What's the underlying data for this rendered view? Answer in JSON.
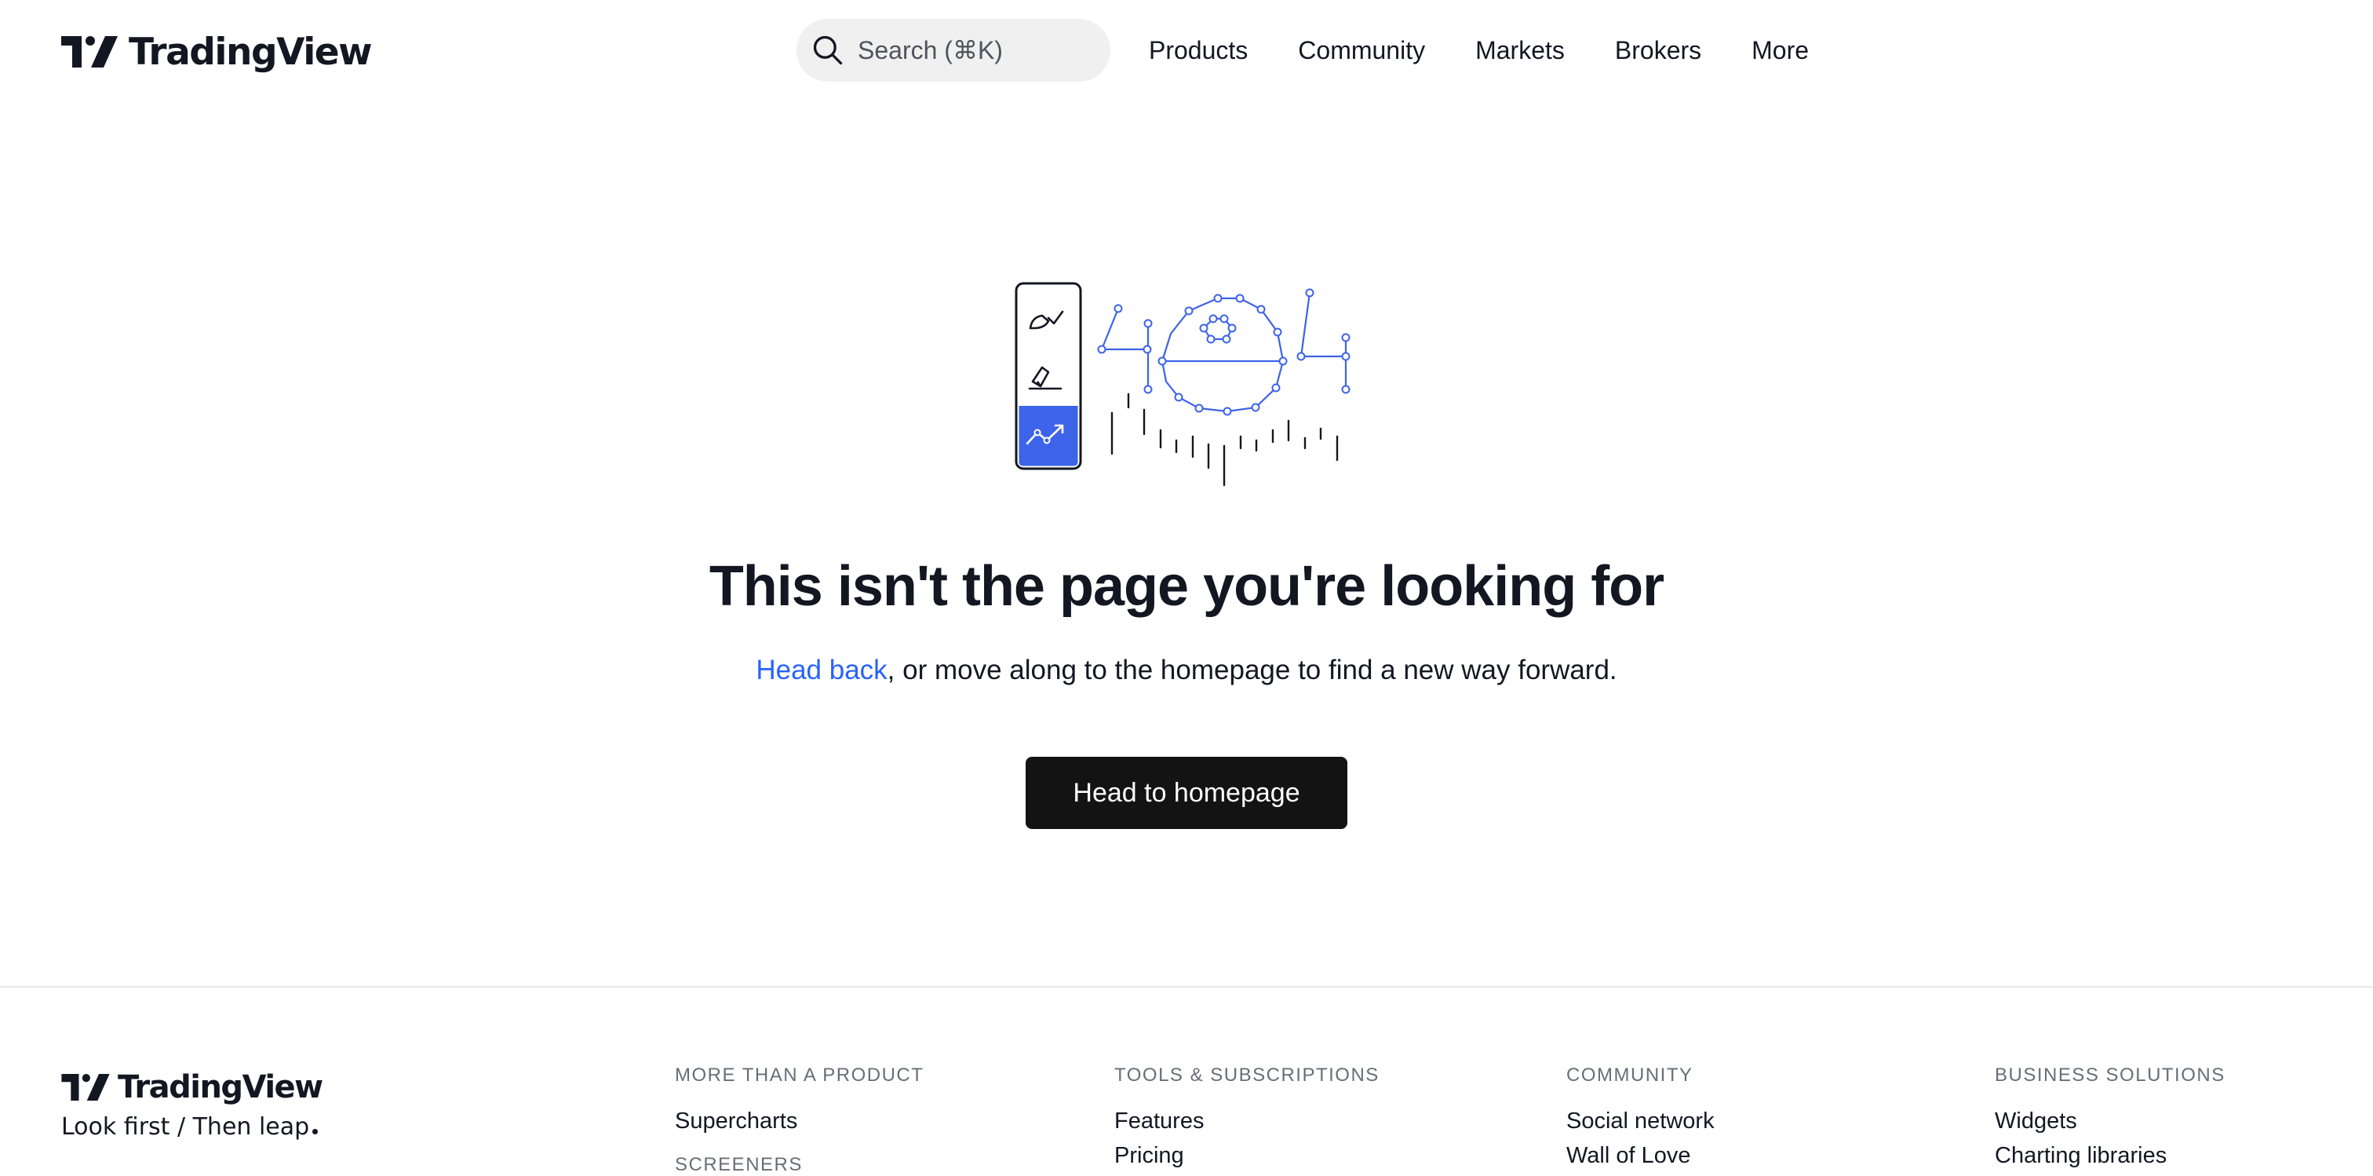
{
  "header": {
    "brand": "TradingView",
    "search_placeholder": "Search (⌘K)",
    "nav": [
      "Products",
      "Community",
      "Markets",
      "Brokers",
      "More"
    ]
  },
  "icons": {
    "logo": "tradingview-logo-icon",
    "search": "search-icon",
    "illustration": "404-illustration"
  },
  "main": {
    "headline": "This isn't the page you're looking for",
    "link_text": "Head back",
    "subline_rest": ", or move along to the homepage to find a new way forward.",
    "cta_label": "Head to homepage"
  },
  "footer": {
    "brand": "TradingView",
    "tagline": "Look first / Then leap",
    "columns": [
      {
        "heading": "MORE THAN A PRODUCT",
        "links": [
          "Supercharts"
        ],
        "subheading": "SCREENERS"
      },
      {
        "heading": "TOOLS & SUBSCRIPTIONS",
        "links": [
          "Features",
          "Pricing"
        ]
      },
      {
        "heading": "COMMUNITY",
        "links": [
          "Social network",
          "Wall of Love"
        ]
      },
      {
        "heading": "BUSINESS SOLUTIONS",
        "links": [
          "Widgets",
          "Charting libraries"
        ]
      }
    ]
  },
  "colors": {
    "text": "#131722",
    "accent_blue": "#2962ff",
    "illustration_blue": "#3d63ea",
    "button_bg": "#131313",
    "search_bg": "#f0f0f0",
    "muted": "#6a6d78"
  }
}
